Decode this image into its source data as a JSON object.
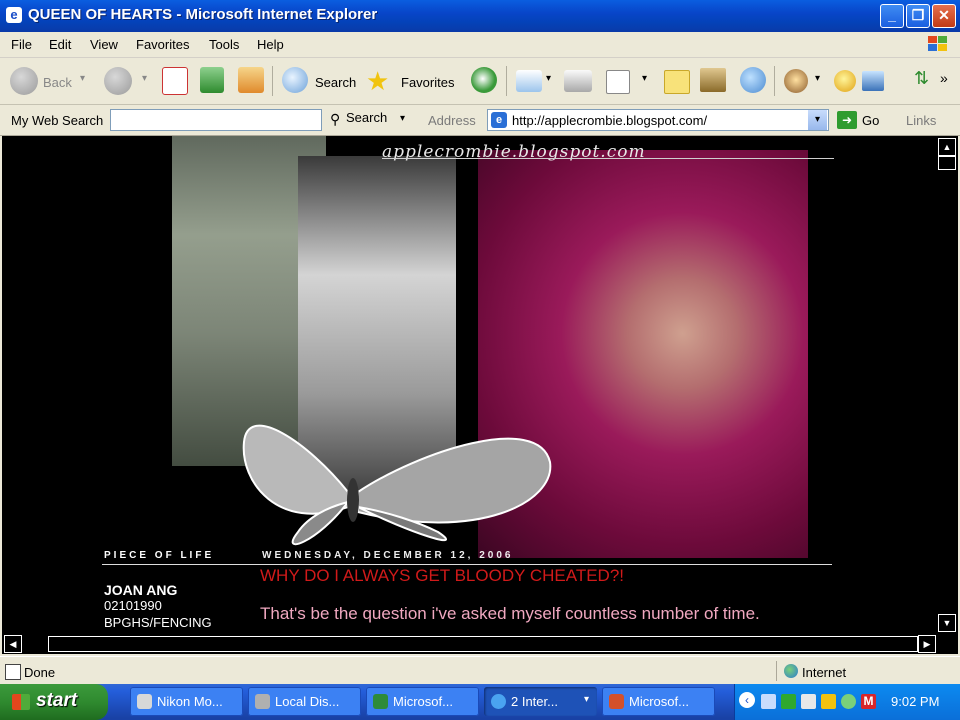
{
  "window": {
    "title": "QUEEN OF HEARTS - Microsoft Internet Explorer",
    "buttons": {
      "minimize": "_",
      "maximize": "❐",
      "close": "✕"
    }
  },
  "menu": [
    "File",
    "Edit",
    "View",
    "Favorites",
    "Tools",
    "Help"
  ],
  "toolbar": {
    "back_label": "Back",
    "search_label": "Search",
    "favorites_label": "Favorites"
  },
  "address_bar": {
    "my_web_search_label": "My Web Search",
    "my_web_search_value": "",
    "search_button_label": "Search",
    "address_label": "Address",
    "url": "http://applecrombie.blogspot.com/",
    "go_label": "Go",
    "links_label": "Links"
  },
  "page": {
    "blog_url": "applecrombie.blogspot.com",
    "sidebar_heading": "PIECE OF LIFE",
    "post_date": "WEDNESDAY, DECEMBER 12, 2006",
    "profile_name": "JOAN ANG",
    "profile_dob": "02101990",
    "profile_school": "BPGHS/FENCING",
    "post_title": "WHY DO I ALWAYS GET BLOODY CHEATED?!",
    "post_body": "That's be the question i've asked myself countless number of time."
  },
  "status_bar": {
    "status": "Done",
    "zone": "Internet"
  },
  "taskbar": {
    "start_label": "start",
    "tasks": [
      {
        "label": "Nikon Mo...",
        "icon": "nikon-icon",
        "color": "#d8d8d8"
      },
      {
        "label": "Local Dis...",
        "icon": "drive-icon",
        "color": "#b0b0b0"
      },
      {
        "label": "Microsof...",
        "icon": "excel-icon",
        "color": "#2e8b3a"
      },
      {
        "label": "2 Inter...",
        "icon": "ie-icon",
        "color": "#4aa3f0"
      },
      {
        "label": "Microsof...",
        "icon": "powerpoint-icon",
        "color": "#d4502a"
      }
    ],
    "clock": "9:02 PM"
  }
}
